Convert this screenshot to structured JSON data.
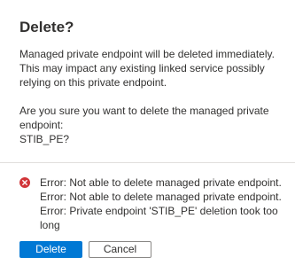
{
  "dialog": {
    "title": "Delete?",
    "message_lines": [
      "Managed private endpoint will be deleted immediately.",
      "This may impact any existing linked service possibly",
      "relying on this private endpoint."
    ],
    "confirm_lines": [
      "Are you sure you want to delete the managed private",
      "endpoint:",
      "STIB_PE?"
    ]
  },
  "errors": {
    "icon": "error-circle-icon",
    "color": "#d13438",
    "lines": [
      "Error: Not able to delete managed private endpoint.",
      "Error: Not able to delete managed private endpoint.",
      "Error: Private endpoint 'STIB_PE' deletion took too",
      "long"
    ]
  },
  "buttons": {
    "delete_label": "Delete",
    "cancel_label": "Cancel"
  },
  "colors": {
    "primary": "#0078d4",
    "text": "#323130",
    "divider": "#e1dfdd"
  }
}
